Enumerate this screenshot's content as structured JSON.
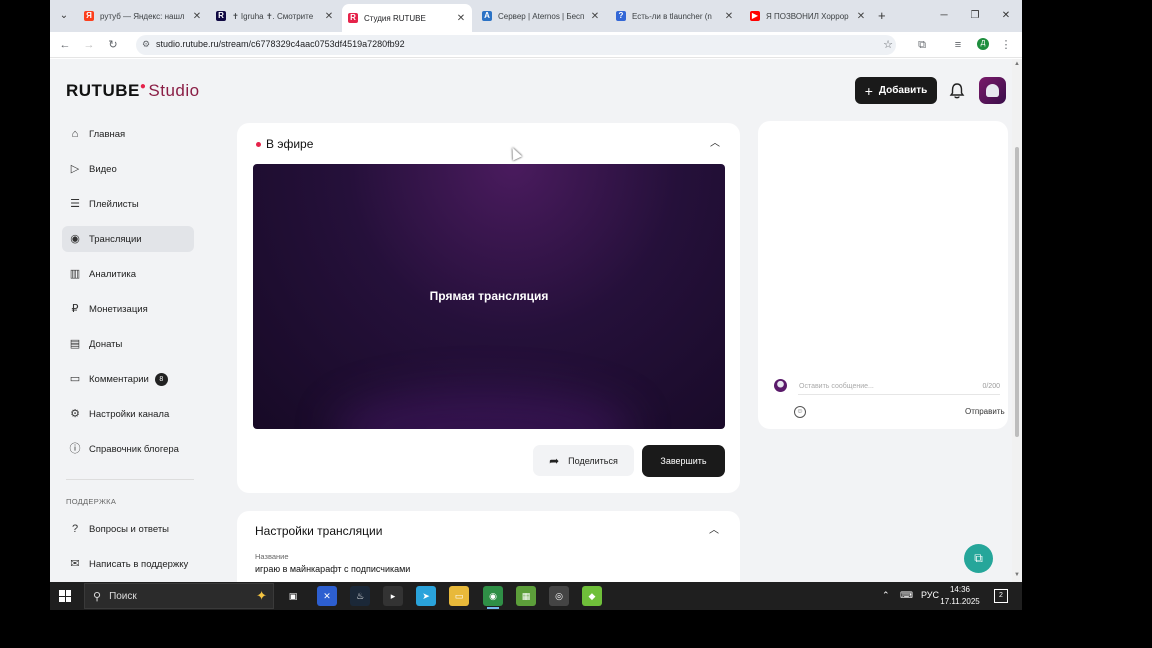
{
  "browser": {
    "tabs": [
      {
        "title": "рутуб — Яндекс: нашл",
        "icon": "yandex-icon",
        "color": "#fc3f1d",
        "glyph": "Я"
      },
      {
        "title": "✝ Igruha ✝. Смотрите",
        "icon": "rutube-icon",
        "color": "#100943",
        "glyph": "R"
      },
      {
        "title": "Студия RUTUBE",
        "icon": "rutube-studio-icon",
        "color": "#e5234a",
        "glyph": "R"
      },
      {
        "title": "Сервер | Aternos | Бесп",
        "icon": "aternos-icon",
        "color": "#2b72c5",
        "glyph": "A"
      },
      {
        "title": "Есть-ли в tlauncher (n",
        "icon": "question-site-icon",
        "color": "#3367d6",
        "glyph": "?"
      },
      {
        "title": "Я ПОЗВОНИЛ Хоррор",
        "icon": "youtube-icon",
        "color": "#ff0000",
        "glyph": "▶"
      }
    ],
    "url": "studio.rutube.ru/stream/c6778329c4aac0753df4519a7280fb92",
    "profile_initial": "Д"
  },
  "header": {
    "logo_main": "RUTUBE",
    "logo_sub": "Studio",
    "add_label": "Добавить"
  },
  "sidebar": {
    "items": [
      {
        "label": "Главная",
        "icon": "home-icon",
        "glyph": "⌂"
      },
      {
        "label": "Видео",
        "icon": "video-icon",
        "glyph": "▷"
      },
      {
        "label": "Плейлисты",
        "icon": "playlist-icon",
        "glyph": "☰"
      },
      {
        "label": "Трансляции",
        "icon": "broadcast-icon",
        "glyph": "◉"
      },
      {
        "label": "Аналитика",
        "icon": "analytics-icon",
        "glyph": "▥"
      },
      {
        "label": "Монетизация",
        "icon": "monetization-icon",
        "glyph": "₽"
      },
      {
        "label": "Донаты",
        "icon": "donations-icon",
        "glyph": "▤"
      },
      {
        "label": "Комментарии",
        "icon": "comments-icon",
        "glyph": "▭",
        "count": "8"
      },
      {
        "label": "Настройки канала",
        "icon": "settings-icon",
        "glyph": "⚙"
      },
      {
        "label": "Справочник блогера",
        "icon": "info-icon",
        "glyph": "ⓘ"
      }
    ],
    "support_heading": "ПОДДЕРЖКА",
    "support_items": [
      {
        "label": "Вопросы и ответы",
        "icon": "help-icon",
        "glyph": "?"
      },
      {
        "label": "Написать в поддержку",
        "icon": "mail-icon",
        "glyph": "✉"
      }
    ]
  },
  "live": {
    "title": "В эфире",
    "player_label": "Прямая трансляция",
    "share_label": "Поделиться",
    "end_label": "Завершить"
  },
  "chat": {
    "placeholder": "Оставить сообщение...",
    "counter": "0/200",
    "send_label": "Отправить"
  },
  "settings": {
    "title": "Настройки трансляции",
    "name_label": "Название",
    "name_value": "играю в майнкарафт с подписчиками"
  },
  "taskbar": {
    "search_label": "Поиск",
    "language": "РУС",
    "time": "14:36",
    "date": "17.11.2025",
    "notifications": "2"
  },
  "colors": {
    "accent": "#e5234a",
    "dark_button": "#1a1a1a",
    "fab": "#26a69a"
  }
}
